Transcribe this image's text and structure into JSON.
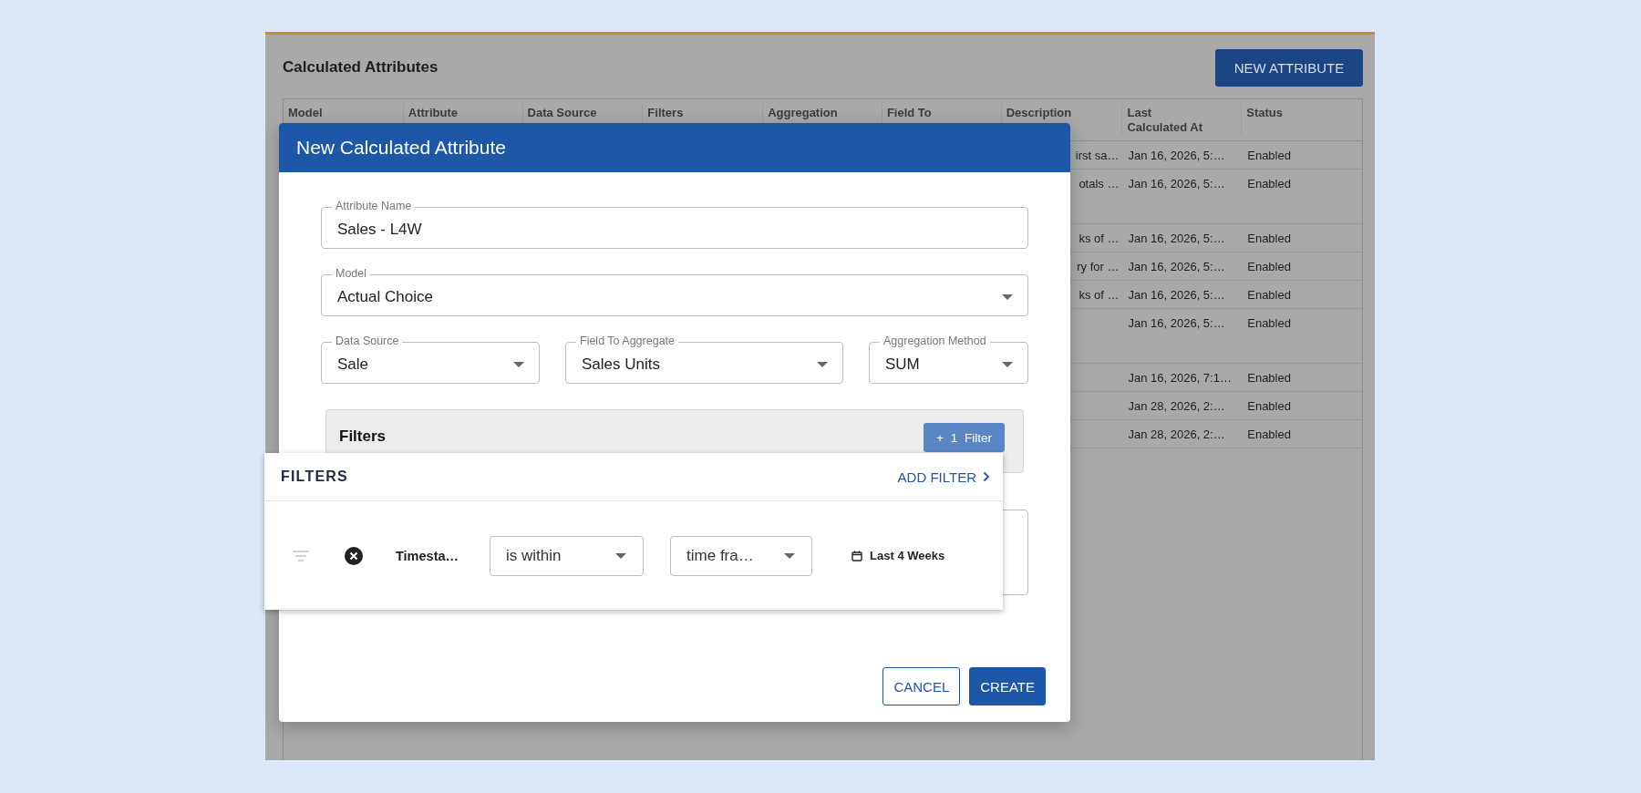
{
  "page": {
    "title": "Calculated Attributes",
    "new_button": "NEW ATTRIBUTE"
  },
  "table": {
    "columns": [
      "Model",
      "Attribute",
      "Data Source",
      "Filters",
      "Aggregation",
      "Field To",
      "Description",
      "Last Calculated At",
      "Status"
    ],
    "rows": [
      {
        "description": "irst sa…",
        "last_calculated_at": "Jan 16, 2026, 5:…",
        "status": "Enabled",
        "wrapped": false
      },
      {
        "description": "otals …",
        "last_calculated_at": "Jan 16, 2026, 5:…",
        "status": "Enabled",
        "wrapped": true
      },
      {
        "description": "ks of …",
        "last_calculated_at": "Jan 16, 2026, 5:…",
        "status": "Enabled",
        "wrapped": false
      },
      {
        "description": "ry for …",
        "last_calculated_at": "Jan 16, 2026, 5:…",
        "status": "Enabled",
        "wrapped": false
      },
      {
        "description": "ks of …",
        "last_calculated_at": "Jan 16, 2026, 5:…",
        "status": "Enabled",
        "wrapped": false
      },
      {
        "last_calculated_at": "Jan 16, 2026, 5:…",
        "status": "Enabled",
        "wrapped": true
      },
      {
        "last_calculated_at": "Jan 16, 2026, 7:1…",
        "status": "Enabled",
        "wrapped": false
      },
      {
        "last_calculated_at": "Jan 28, 2026, 2:…",
        "status": "Enabled",
        "wrapped": false
      },
      {
        "last_calculated_at": "Jan 28, 2026, 2:…",
        "status": "Enabled",
        "wrapped": false
      }
    ]
  },
  "dialog": {
    "title": "New Calculated Attribute",
    "fields": [
      {
        "kind": "text",
        "label": "Attribute Name",
        "value": "Sales - L4W"
      },
      {
        "kind": "select",
        "label": "Model",
        "value": "Actual Choice"
      },
      {
        "kind": "select",
        "label": "Data Source",
        "value": "Sale"
      },
      {
        "kind": "select",
        "label": "Field To Aggregate",
        "value": "Sales Units"
      },
      {
        "kind": "select",
        "label": "Aggregation Method",
        "value": "SUM"
      }
    ],
    "filters": {
      "title": "Filters",
      "add_button": "+ 1 Filter"
    },
    "buttons": [
      {
        "label": "CANCEL",
        "kind": "outlined"
      },
      {
        "label": "CREATE",
        "kind": "filled"
      }
    ]
  },
  "filter_popover": {
    "title": "FILTERS",
    "add_filter": "ADD FILTER",
    "rows": [
      {
        "field": "Timesta…",
        "operator": "is within",
        "value_type": "time fra…",
        "range": "Last 4 Weeks"
      }
    ]
  }
}
